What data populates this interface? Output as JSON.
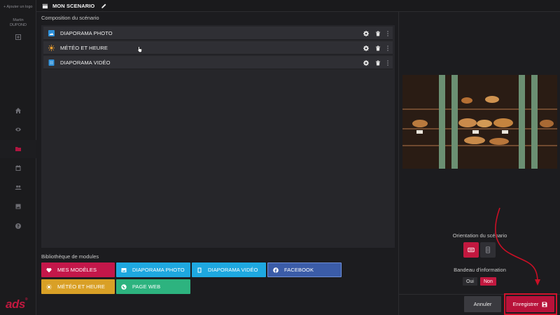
{
  "rail": {
    "add_logo": "+ Ajouter un logo",
    "user_first": "Martin",
    "user_last": "DUPOND",
    "brand": "ads",
    "icons": [
      "plus-square-icon",
      "home-icon",
      "eye-icon",
      "folder-icon",
      "calendar-icon",
      "users-icon",
      "image-icon",
      "help-icon"
    ],
    "active_icon": "folder-icon"
  },
  "topbar": {
    "title": "MON SCENARIO"
  },
  "composition": {
    "label": "Composition du scénario",
    "items": [
      {
        "label": "DIAPORAMA PHOTO",
        "icon": "photo-icon",
        "icon_color": "#2d8fd8"
      },
      {
        "label": "MÉTÉO ET HEURE",
        "icon": "sun-icon",
        "icon_color": "#f0a030"
      },
      {
        "label": "DIAPORAMA VIDÉO",
        "icon": "video-icon",
        "icon_color": "#2d8fd8"
      }
    ]
  },
  "library": {
    "label": "Bibliothèque de modules",
    "modules": [
      {
        "label": "MES MODÈLES",
        "icon": "heart-icon",
        "color": "#c4174a"
      },
      {
        "label": "DIAPORAMA PHOTO",
        "icon": "photo-icon",
        "color": "#1ea8e0"
      },
      {
        "label": "DIAPORAMA VIDÉO",
        "icon": "video-icon",
        "color": "#1ea8e0"
      },
      {
        "label": "FACEBOOK",
        "icon": "facebook-icon",
        "color": "#3b5ca8"
      },
      {
        "label": "MÉTÉO ET HEURE",
        "icon": "sun-icon",
        "color": "#d9a026"
      },
      {
        "label": "PAGE WEB",
        "icon": "globe-icon",
        "color": "#2db37f"
      }
    ]
  },
  "settings": {
    "orientation_label": "Orientation du scénario",
    "orientation_selected": "landscape",
    "band_label": "Bandeau d'information",
    "band_yes": "Oui",
    "band_no": "Non",
    "band_selected": "Non"
  },
  "actions": {
    "cancel": "Annuler",
    "save": "Enregistrer"
  },
  "colors": {
    "accent": "#c2183f",
    "highlight": "#d0132c"
  }
}
